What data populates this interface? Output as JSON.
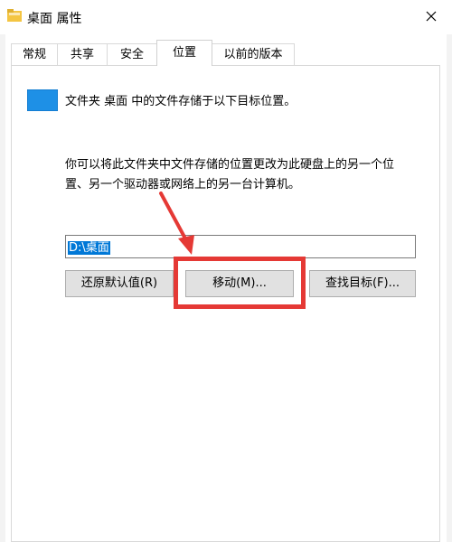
{
  "window": {
    "title": "桌面 属性",
    "icon": "folder-icon",
    "close_icon": "close-icon"
  },
  "tabs": [
    {
      "label": "常规"
    },
    {
      "label": "共享"
    },
    {
      "label": "安全"
    },
    {
      "label": "位置",
      "active": true
    },
    {
      "label": "以前的版本"
    }
  ],
  "location": {
    "folder_icon": "folder-icon",
    "description": "文件夹 桌面 中的文件存储于以下目标位置。",
    "info_line1": "你可以将此文件夹中文件存储的位置更改为此硬盘上的另一个位",
    "info_line2": "置、另一个驱动器或网络上的另一台计算机。",
    "path_value": "D:\\桌面",
    "buttons": {
      "restore": "还原默认值(R)",
      "move": "移动(M)...",
      "find": "查找目标(F)..."
    }
  },
  "annotation": {
    "color": "#e53935"
  },
  "colors": {
    "selection": "#0078d7",
    "button_bg": "#e1e1e1"
  }
}
